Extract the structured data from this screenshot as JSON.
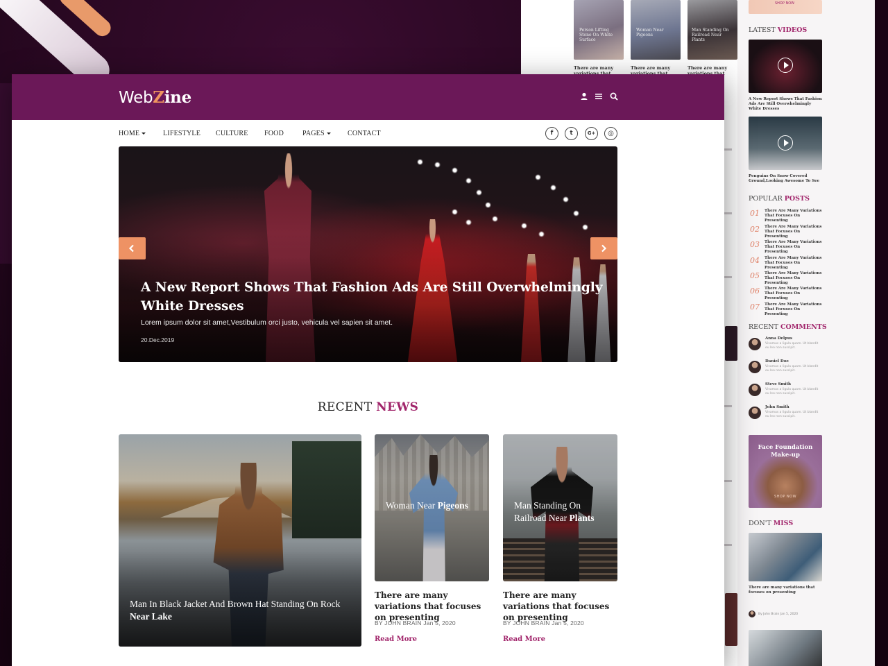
{
  "brand": {
    "logo_prefix": "Web",
    "logo_z": "Z",
    "logo_suffix": "ine"
  },
  "nav": {
    "items": [
      {
        "label": "HOME",
        "dropdown": true
      },
      {
        "label": "LIFESTYLE",
        "dropdown": false
      },
      {
        "label": "CULTURE",
        "dropdown": false
      },
      {
        "label": "FOOD",
        "dropdown": false
      },
      {
        "label": "PAGES",
        "dropdown": true
      },
      {
        "label": "CONTACT",
        "dropdown": false
      }
    ],
    "social": [
      {
        "icon": "facebook-icon",
        "glyph": "f"
      },
      {
        "icon": "twitter-icon",
        "glyph": "t"
      },
      {
        "icon": "google-plus-icon",
        "glyph": "G+"
      },
      {
        "icon": "instagram-icon",
        "glyph": "◎"
      }
    ],
    "top_icons": [
      "user-icon",
      "menu-icon",
      "search-icon"
    ]
  },
  "hero": {
    "title": "A New Report Shows That Fashion Ads Are Still Overwhelmingly White Dresses",
    "description": "Lorem ipsum dolor sit amet,Vestibulum orci justo, vehicula vel sapien sit amet.",
    "date": "20.Dec.2019"
  },
  "recent_news": {
    "title_plain": "RECENT",
    "title_accent": "NEWS",
    "featured": {
      "caption_plain": "Man In Black Jacket And Brown Hat Standing On Rock",
      "caption_bold": "Near Lake"
    },
    "cards": [
      {
        "image_caption_plain": "Woman Near",
        "image_caption_bold": "Pigeons",
        "title": "There are many variations that focuses on presenting",
        "meta_by": "BY",
        "author": "JOHN BRAIN",
        "date": "Jan 5, 2020",
        "read_more": "Read More"
      },
      {
        "image_caption_plain": "Man Standing On Railroad Near",
        "image_caption_bold": "Plants",
        "title": "There are many variations that focuses on presenting",
        "meta_by": "BY",
        "author": "JOHN BRAIN",
        "date": "Jan 5, 2020",
        "read_more": "Read More"
      }
    ]
  },
  "back_page": {
    "top_thumbs": [
      {
        "caption": "Person Lifting Stone On White Surface",
        "title": "There are many variations that focuses"
      },
      {
        "caption": "Woman Near Pigeons",
        "title": "There are many variations that focuses"
      },
      {
        "caption": "Man Standing On Railroad Near Plants",
        "title": "There are many variations that focuses"
      }
    ],
    "top_ad_label": "SHOP NOW",
    "latest_videos": {
      "plain": "LATEST",
      "accent": "VIDEOS",
      "items": [
        {
          "caption": "A New Report Shows That Fashion Ads Are Still Overwhelmingly White Dresses"
        },
        {
          "caption": "Penguins On Snow Covered Ground,Looking Awesome To See"
        }
      ]
    },
    "popular_posts": {
      "plain": "POPULAR",
      "accent": "POSTS",
      "items": [
        {
          "num": "01",
          "text": "There Are Many Variations That Focuses On Presenting"
        },
        {
          "num": "02",
          "text": "There Are Many Variations That Focuses On Presenting"
        },
        {
          "num": "03",
          "text": "There Are Many Variations That Focuses On Presenting"
        },
        {
          "num": "04",
          "text": "There Are Many Variations That Focuses On Presenting"
        },
        {
          "num": "05",
          "text": "There Are Many Variations That Focuses On Presenting"
        },
        {
          "num": "06",
          "text": "There Are Many Variations That Focuses On Presenting"
        },
        {
          "num": "07",
          "text": "There Are Many Variations That Focuses On Presenting"
        }
      ]
    },
    "recent_comments": {
      "plain": "RECENT",
      "accent": "COMMENTS",
      "items": [
        {
          "name": "Anna Delpus",
          "body": "Vivamus a ligula quam. Ut blandit eu leo non suscipit."
        },
        {
          "name": "Daniel Doe",
          "body": "Vivamus a ligula quam. Ut blandit eu leo non suscipit."
        },
        {
          "name": "Steve Smith",
          "body": "Vivamus a ligula quam. Ut blandit eu leo non suscipit."
        },
        {
          "name": "John Smith",
          "body": "Vivamus a ligula quam. Ut blandit eu leo non suscipit."
        }
      ]
    },
    "ad": {
      "title": "Face Foundation Make-up",
      "shop": "SHOP NOW"
    },
    "dont_miss": {
      "plain": "DON'T",
      "accent": "MISS",
      "title": "There are many variations that focuses on presenting",
      "meta": "By John Brain Jan 5, 2020"
    }
  },
  "colors": {
    "brand_purple": "#6b1858",
    "accent_magenta": "#a1256b",
    "accent_orange": "#ee9264"
  }
}
